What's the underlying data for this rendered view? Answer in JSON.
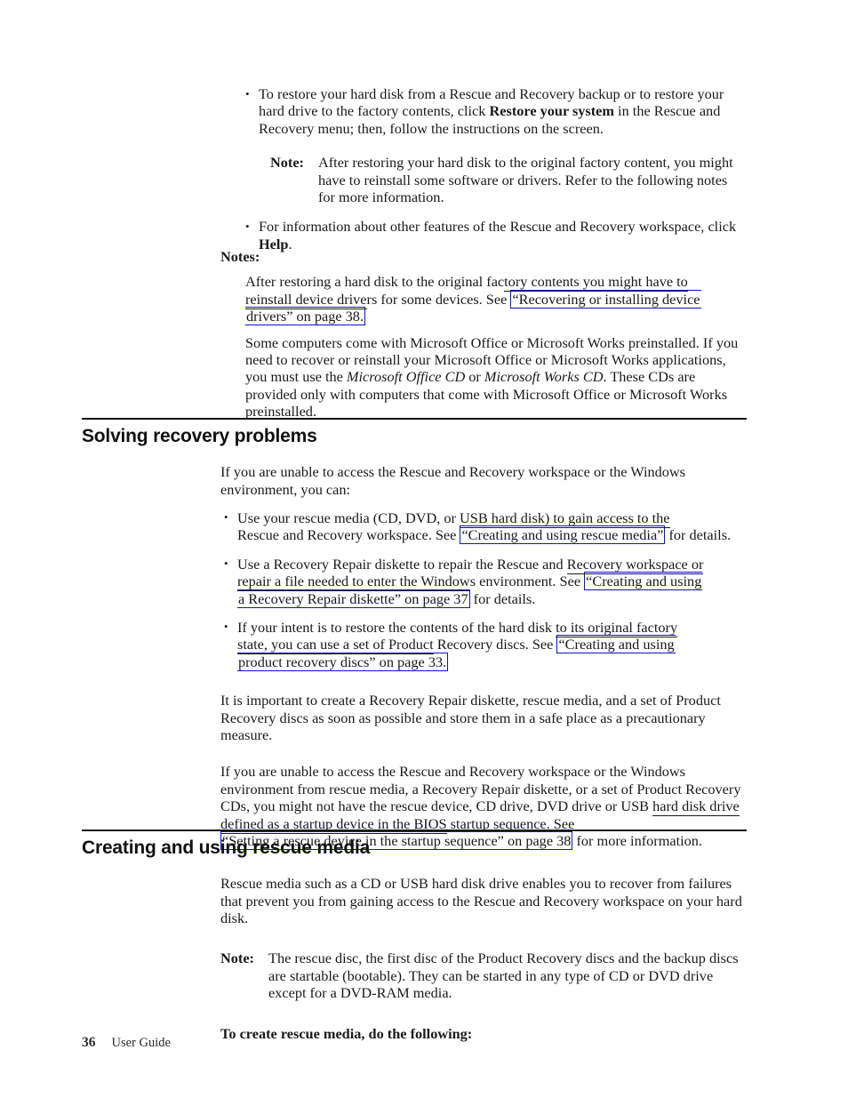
{
  "document": {
    "title": "User Guide",
    "page_number": "36",
    "footer_label": "User Guide"
  },
  "intro_bullets": {
    "bullet1": {
      "marker": "•",
      "part1": "To restore your hard disk from a Rescue and Recovery backup or to restore your hard drive to the factory contents, click ",
      "bold1": "Restore your system",
      "part2": " in the Rescue and Recovery menu; then, follow the instructions on the screen."
    },
    "note": {
      "label": "Note:",
      "text": "After restoring your hard disk to the original factory content, you might have to reinstall some software or drivers. Refer to the following notes for more information."
    },
    "bullet2": {
      "marker": "•",
      "part1": "For information about other features of the Rescue and Recovery workspace, click ",
      "bold1": "Help",
      "part2": "."
    }
  },
  "notes": {
    "heading": "Notes:",
    "note1": {
      "text_before": "After restoring a hard disk to the original fac",
      "underlined_run1": "tory contents you might have to",
      "underlined_run2": "reinstall device drive",
      "text_mid": "rs for some devices. See ",
      "link_part1": "“Recovering or installing device",
      "link_part2": "drivers” on page 38."
    },
    "note2": {
      "part1": "Some computers come with Microsoft Office or Microsoft Works preinstalled. If you need to recover or reinstall your Microsoft Office or Microsoft Works applications, you must use the ",
      "italic1": "Microsoft Office CD",
      "part2": " or ",
      "italic2": "Microsoft Works CD",
      "part3": ". These CDs are provided only with computers that come with Microsoft Office or Microsoft Works preinstalled."
    }
  },
  "section_solving": {
    "title": "Solving recovery problems",
    "intro": "If you are unable to access the Rescue and Recovery workspace or the Windows environment, you can:",
    "bullets": [
      {
        "marker": "•",
        "text_before": "Use your rescue media (CD, DVD, or ",
        "underlined_run": "USB hard disk) to gain access to the",
        "text_mid": "Rescue and Recovery workspace. See ",
        "link_part1": "“Creating and using rescue media”",
        "text_after": " for details."
      },
      {
        "marker": "•",
        "text_before": "Use a Recovery Repair diskette to repair the Rescue and ",
        "underlined_run1": "Recovery workspace or",
        "underlined_run2": "repair a file needed to enter the Window",
        "text_mid": "s environment. See ",
        "link_part1": "“Creating and using",
        "link_part2": "a Recovery Repair diskette” on page 37",
        "text_after": " for details."
      },
      {
        "marker": "•",
        "text_before": "If your intent is to restore the contents of the hard disk ",
        "underlined_run1": "to its original factory",
        "underlined_run2": "state, you can use a set of Product",
        "text_mid": " Recovery discs. See ",
        "link_part1": "“Creating and using",
        "link_part2": "product recovery discs” on page 33."
      }
    ],
    "para_important": "It is important to create a Recovery Repair diskette, rescue media, and a set of Product Recovery discs as soon as possible and store them in a safe place as a precautionary measure.",
    "para_bios": {
      "part1": "If you are unable to access the Rescue and Recovery workspace or the Windows environment from rescue media, a Recovery Repair diskette, or a set of Product Recovery CDs, you might not have the rescue device, CD drive, DVD drive or USB ",
      "underlined_run": "hard disk drive defined as a startup device in the BIOS",
      "part2": " startup sequence. See ",
      "link": "“Setting a rescue device in the startup sequence” on page 38",
      "part3": " for more information."
    }
  },
  "section_rescue_media": {
    "title": "Creating and using rescue media",
    "intro": "Rescue media such as a CD or USB hard disk drive enables you to recover from failures that prevent you from gaining access to the Rescue and Recovery workspace on your hard disk.",
    "note": {
      "label": "Note:",
      "text": "The rescue disc, the first disc of the Product Recovery discs and the backup discs are startable (bootable). They can be started in any type of CD or DVD drive except for a DVD-RAM media."
    },
    "lead_in": "To create rescue media, do the following:"
  },
  "colors": {
    "link_border": "#1111cc",
    "text": "#1a1a1a",
    "rule": "#121212"
  }
}
